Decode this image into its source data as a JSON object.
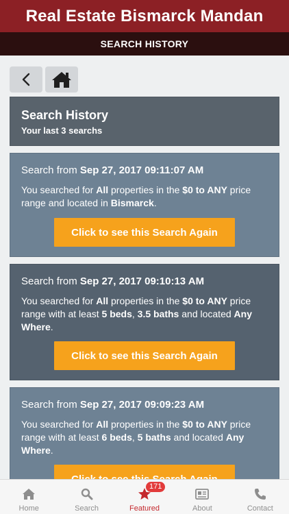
{
  "header": {
    "title": "Real Estate Bismarck Mandan"
  },
  "subheader": {
    "title": "SEARCH HISTORY"
  },
  "nav": {
    "back_icon": "chevron-left-icon",
    "home_icon": "home-icon"
  },
  "panel": {
    "title": "Search History",
    "subtitle": "Your last 3 searchs"
  },
  "searches": [
    {
      "prefix": "Search from ",
      "date": "Sep 27, 2017 09:11:07 AM",
      "t1": "You searched for ",
      "b1": "All",
      "t2": " properties in the ",
      "b2": "$0 to ANY",
      "t3": " price range and located in ",
      "b3": "Bismarck",
      "t4": ".",
      "button": "Click to see this Search Again"
    },
    {
      "prefix": "Search from ",
      "date": "Sep 27, 2017 09:10:13 AM",
      "t1": "You searched for ",
      "b1": "All",
      "t2": " properties in the ",
      "b2": "$0 to ANY",
      "t3": " price range with at least ",
      "b3": "5 beds",
      "t4": ", ",
      "b4": "3.5 baths",
      "t5": " and located ",
      "b5": "Any Where",
      "t6": ".",
      "button": "Click to see this Search Again"
    },
    {
      "prefix": "Search from ",
      "date": "Sep 27, 2017 09:09:23 AM",
      "t1": "You searched for ",
      "b1": "All",
      "t2": " properties in the ",
      "b2": "$0 to ANY",
      "t3": " price range with at least ",
      "b3": "6 beds",
      "t4": ", ",
      "b4": "5 baths",
      "t5": " and located ",
      "b5": "Any Where",
      "t6": ".",
      "button": "Click to see this Search Again"
    }
  ],
  "tabbar": {
    "home": "Home",
    "search": "Search",
    "featured": "Featured",
    "featured_badge": "171",
    "about": "About",
    "contact": "Contact"
  },
  "colors": {
    "header": "#8c2025",
    "subheader": "#2b0f0f",
    "button": "#f6a21c",
    "active_tab": "#c4282d"
  }
}
